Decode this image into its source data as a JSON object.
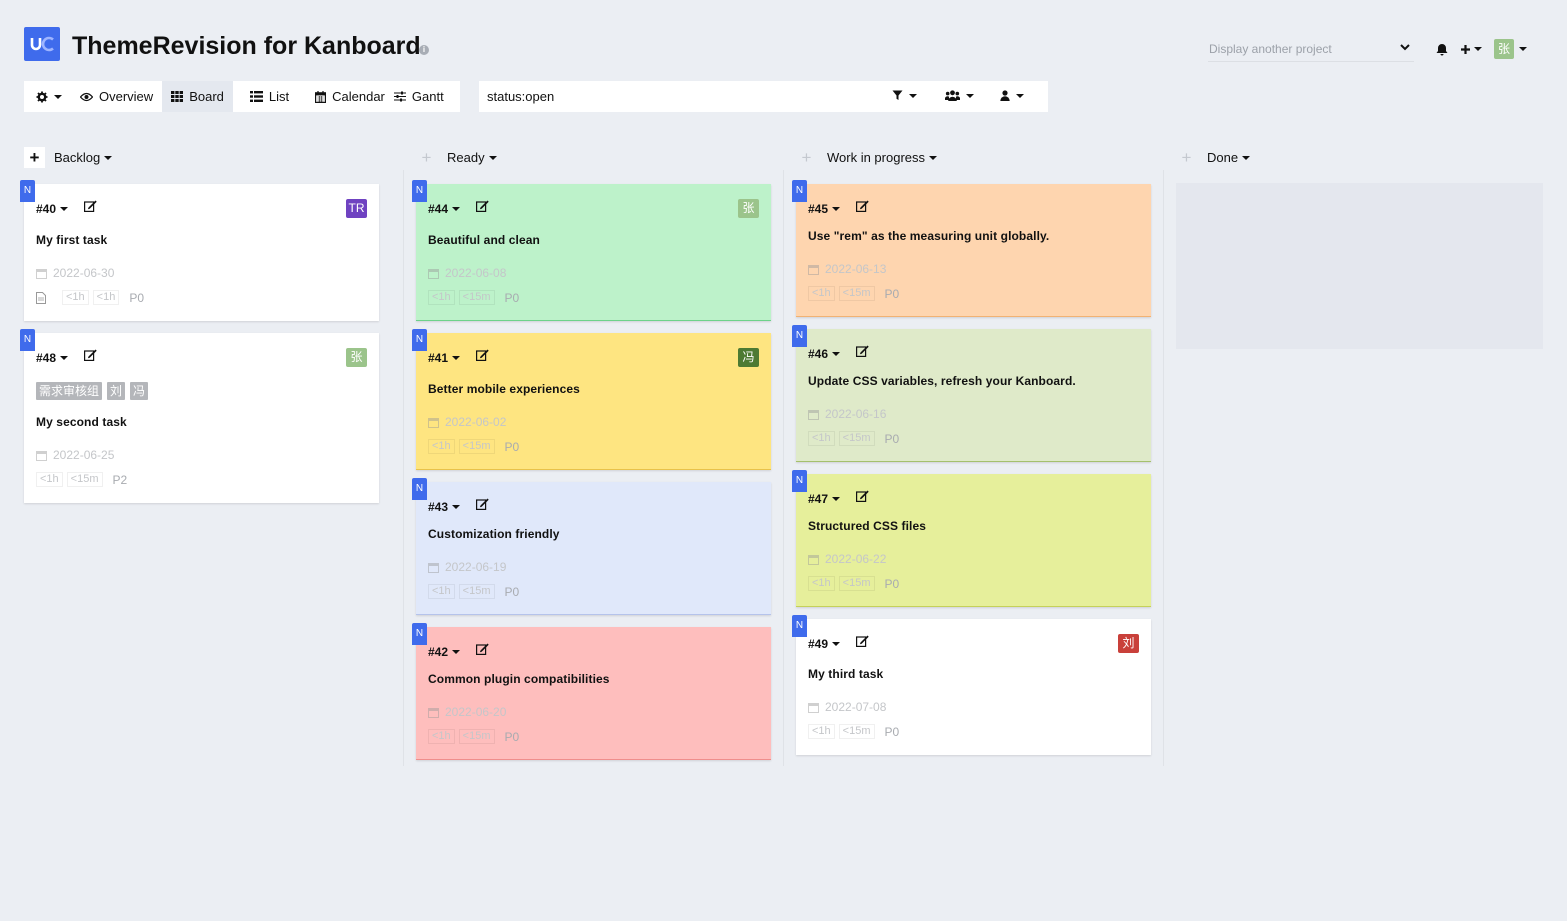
{
  "header": {
    "title": "ThemeRevision for Kanboard",
    "project_select_placeholder": "Display another project",
    "user_avatar": "张",
    "logo_icon": "uc-logo-icon"
  },
  "views": {
    "settings": "gear-icon",
    "overview": "Overview",
    "board": "Board",
    "list": "List",
    "calendar": "Calendar",
    "gantt": "Gantt",
    "active": "Board"
  },
  "filter": {
    "value": "status:open"
  },
  "columns": [
    {
      "name": "Backlog"
    },
    {
      "name": "Ready"
    },
    {
      "name": "Work in progress"
    },
    {
      "name": "Done"
    }
  ],
  "cards": [
    {
      "id": "#40",
      "title": "My first task",
      "date": "2022-06-30",
      "time1": "<1h",
      "time2": "<1h",
      "priority": "P0",
      "assignee": "TR",
      "assignee_color": "#6f42c1",
      "bg": "#ffffff",
      "border": "#ffffff",
      "badge": "N",
      "has_doc_icon": true
    },
    {
      "id": "#48",
      "title": "My second task",
      "date": "2022-06-25",
      "time1": "<1h",
      "time2": "<15m",
      "priority": "P2",
      "assignee": "张",
      "assignee_color": "#9bc48b",
      "bg": "#ffffff",
      "border": "#ffffff",
      "badge": "N",
      "tags": [
        "需求审核组",
        "刘",
        "冯"
      ]
    },
    {
      "id": "#44",
      "title": "Beautiful and clean",
      "date": "2022-06-08",
      "time1": "<1h",
      "time2": "<15m",
      "priority": "P0",
      "assignee": "张",
      "assignee_color": "#9bc48b",
      "bg": "#bdf2ca",
      "border": "#6dd28a",
      "badge": "N"
    },
    {
      "id": "#41",
      "title": "Better mobile experiences",
      "date": "2022-06-02",
      "time1": "<1h",
      "time2": "<15m",
      "priority": "P0",
      "assignee": "冯",
      "assignee_color": "#4d7a33",
      "bg": "#fee581",
      "border": "#e8c24a",
      "badge": "N"
    },
    {
      "id": "#43",
      "title": "Customization friendly",
      "date": "2022-06-19",
      "time1": "<1h",
      "time2": "<15m",
      "priority": "P0",
      "assignee": "",
      "assignee_color": "",
      "bg": "#e0e8fa",
      "border": "#b5c3eb",
      "badge": "N"
    },
    {
      "id": "#42",
      "title": "Common plugin compatibilities",
      "date": "2022-06-20",
      "time1": "<1h",
      "time2": "<15m",
      "priority": "P0",
      "assignee": "",
      "assignee_color": "",
      "bg": "#febebd",
      "border": "#ef8e8c",
      "badge": "N"
    },
    {
      "id": "#45",
      "title": "Use \"rem\" as the measuring unit globally.",
      "date": "2022-06-13",
      "time1": "<1h",
      "time2": "<15m",
      "priority": "P0",
      "assignee": "",
      "assignee_color": "",
      "bg": "#fed5af",
      "border": "#f1b274",
      "badge": "N"
    },
    {
      "id": "#46",
      "title": "Update CSS variables, refresh your Kanboard.",
      "date": "2022-06-16",
      "time1": "<1h",
      "time2": "<15m",
      "priority": "P0",
      "assignee": "",
      "assignee_color": "",
      "bg": "#dfeac9",
      "border": "#a5c06d",
      "badge": "N"
    },
    {
      "id": "#47",
      "title": "Structured CSS files",
      "date": "2022-06-22",
      "time1": "<1h",
      "time2": "<15m",
      "priority": "P0",
      "assignee": "",
      "assignee_color": "",
      "bg": "#e6ef9b",
      "border": "#c5d15a",
      "badge": "N"
    },
    {
      "id": "#49",
      "title": "My third task",
      "date": "2022-07-08",
      "time1": "<1h",
      "time2": "<15m",
      "priority": "P0",
      "assignee": "刘",
      "assignee_color": "#c9403a",
      "bg": "#ffffff",
      "border": "#ffffff",
      "badge": "N"
    }
  ]
}
